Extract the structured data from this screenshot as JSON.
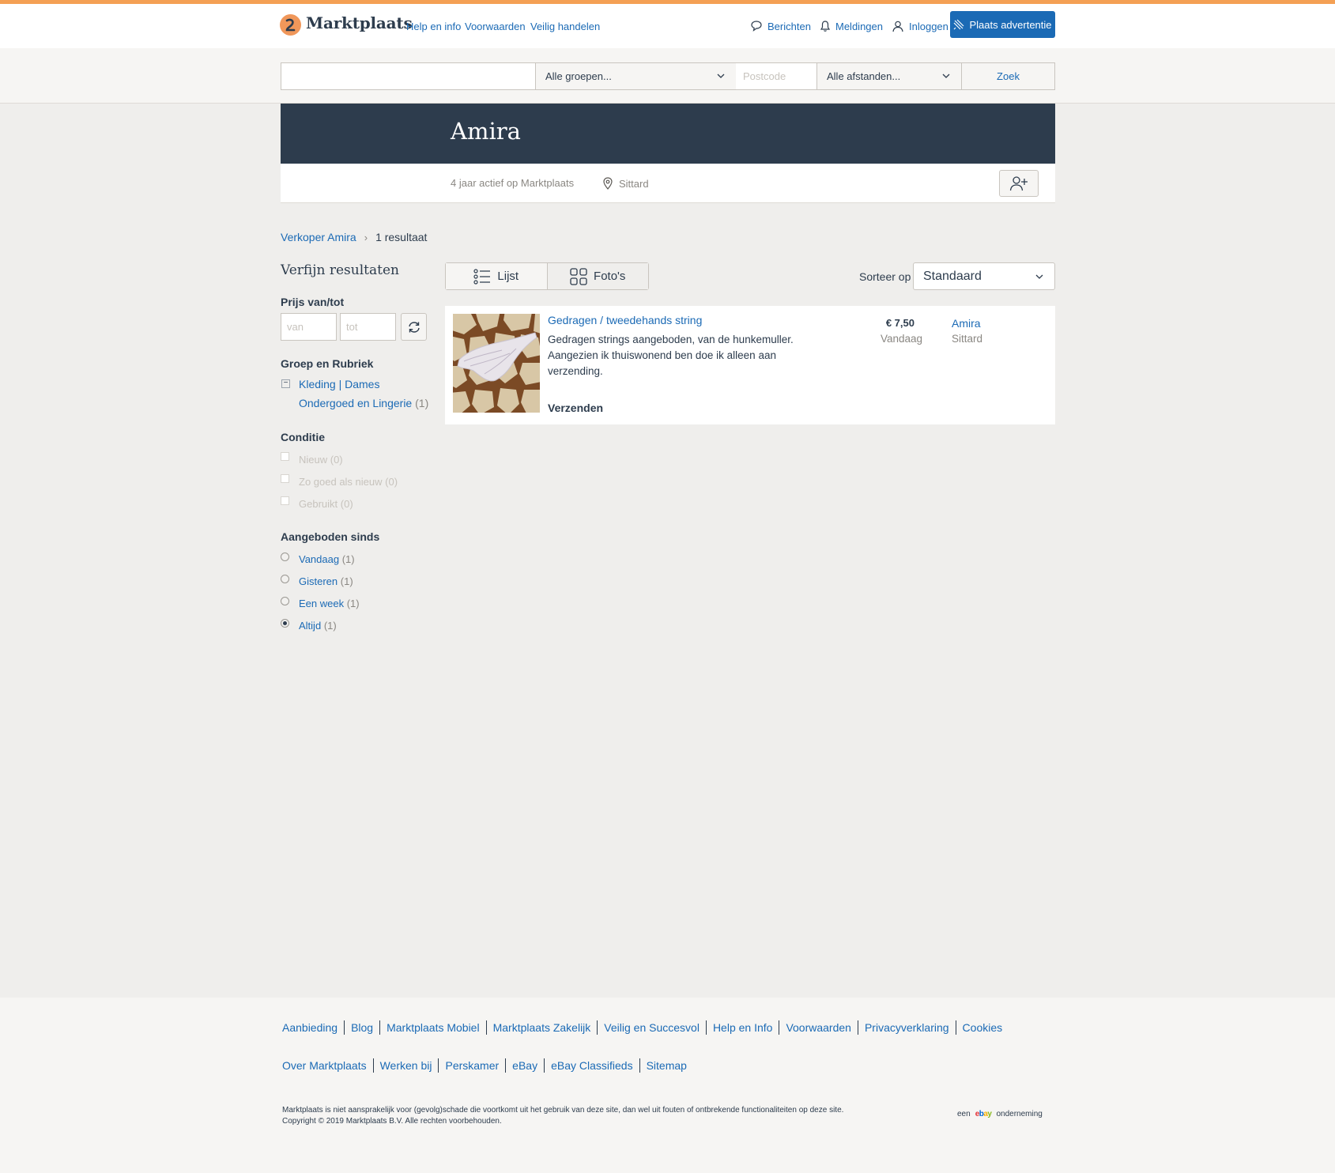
{
  "header": {
    "logo_text": "Marktplaats",
    "nav": [
      "Help en info",
      "Voorwaarden",
      "Veilig handelen"
    ],
    "messages": "Berichten",
    "notifications": "Meldingen",
    "login": "Inloggen",
    "place_ad": "Plaats advertentie"
  },
  "search": {
    "query_value": "",
    "group_select": "Alle groepen...",
    "postcode_placeholder": "Postcode",
    "distance_select": "Alle afstanden...",
    "button": "Zoek"
  },
  "seller": {
    "name": "Amira",
    "active": "4 jaar actief op Marktplaats",
    "location": "Sittard"
  },
  "breadcrumb": {
    "seller_link": "Verkoper Amira",
    "results": "1 resultaat"
  },
  "sidebar": {
    "title": "Verfijn resultaten",
    "price_heading": "Prijs van/tot",
    "price_from_placeholder": "van",
    "price_to_placeholder": "tot",
    "group_heading": "Groep en Rubriek",
    "category_parent": "Kleding | Dames",
    "category_child": "Ondergoed en Lingerie",
    "category_child_count": "(1)",
    "condition_heading": "Conditie",
    "conditions": [
      {
        "label": "Nieuw",
        "count": "(0)"
      },
      {
        "label": "Zo goed als nieuw",
        "count": "(0)"
      },
      {
        "label": "Gebruikt",
        "count": "(0)"
      }
    ],
    "since_heading": "Aangeboden sinds",
    "since_options": [
      {
        "label": "Vandaag",
        "count": "(1)",
        "selected": false
      },
      {
        "label": "Gisteren",
        "count": "(1)",
        "selected": false
      },
      {
        "label": "Een week",
        "count": "(1)",
        "selected": false
      },
      {
        "label": "Altijd",
        "count": "(1)",
        "selected": true
      }
    ]
  },
  "view": {
    "list_label": "Lijst",
    "photos_label": "Foto's",
    "sort_label": "Sorteer op",
    "sort_value": "Standaard"
  },
  "listing": {
    "title": "Gedragen / tweedehands string",
    "description": "Gedragen strings aangeboden, van de hunkemuller. Aangezien ik thuiswonend ben doe ik alleen aan verzending.",
    "shipping": "Verzenden",
    "price": "€ 7,50",
    "date": "Vandaag",
    "seller": "Amira",
    "city": "Sittard"
  },
  "footer": {
    "row1": [
      "Aanbieding",
      "Blog",
      "Marktplaats Mobiel",
      "Marktplaats Zakelijk",
      "Veilig en Succesvol",
      "Help en Info",
      "Voorwaarden",
      "Privacyverklaring",
      "Cookies"
    ],
    "row2": [
      "Over Marktplaats",
      "Werken bij",
      "Perskamer",
      "eBay",
      "eBay Classifieds",
      "Sitemap"
    ],
    "legal_line1": "Marktplaats is niet aansprakelijk voor (gevolg)schade die voortkomt uit het gebruik van deze site, dan wel uit fouten of ontbrekende functionaliteiten op deze site.",
    "legal_line2": "Copyright © 2019 Marktplaats B.V. Alle rechten voorbehouden.",
    "ebay_prefix": "een",
    "ebay_logo": "ebay",
    "ebay_suffix": "onderneming"
  },
  "colors": {
    "accent_orange": "#f4a054",
    "brand_blue": "#1b6ab5",
    "banner_navy": "#2d3c4d"
  }
}
